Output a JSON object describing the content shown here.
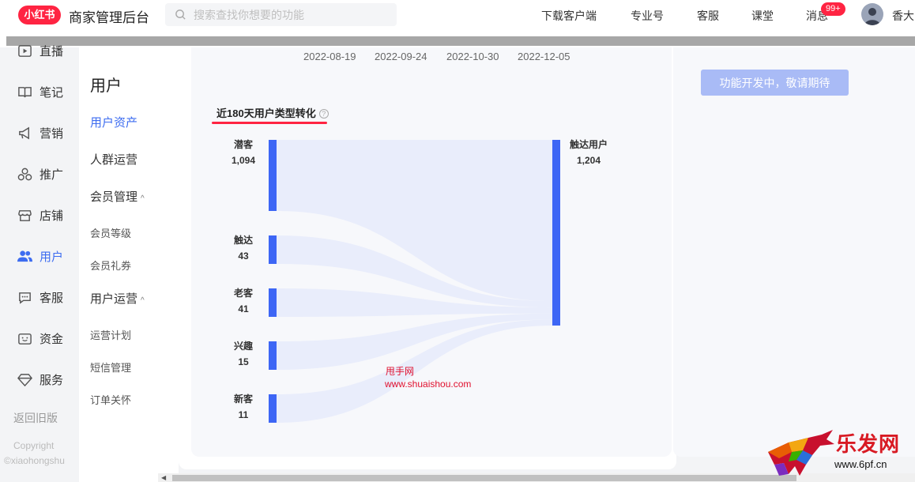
{
  "header": {
    "logo_text": "小红书",
    "app_title": "商家管理后台",
    "search_placeholder": "搜索查找你想要的功能",
    "links": [
      "下载客户端",
      "专业号",
      "客服",
      "课堂",
      "消息"
    ],
    "message_badge": "99+",
    "username": "香大"
  },
  "sidenav": {
    "items": [
      {
        "label": "直播",
        "icon": "play-icon"
      },
      {
        "label": "笔记",
        "icon": "book-icon"
      },
      {
        "label": "营销",
        "icon": "megaphone-icon"
      },
      {
        "label": "推广",
        "icon": "share-nodes-icon"
      },
      {
        "label": "店铺",
        "icon": "store-icon"
      },
      {
        "label": "用户",
        "icon": "users-icon",
        "active": true
      },
      {
        "label": "客服",
        "icon": "chat-icon"
      },
      {
        "label": "资金",
        "icon": "wallet-icon"
      },
      {
        "label": "服务",
        "icon": "diamond-icon"
      }
    ],
    "back_old": "返回旧版",
    "copyright": "Copyright",
    "copyright_sub": "©xiaohongshu"
  },
  "submenu": {
    "title": "用户",
    "items": [
      "用户资产",
      "人群运营",
      "会员管理",
      "会员等级",
      "会员礼券",
      "用户运营",
      "运营计划",
      "短信管理",
      "订单关怀"
    ]
  },
  "main": {
    "dates": [
      "2022-08-19",
      "2022-09-24",
      "2022-10-30",
      "2022-12-05"
    ],
    "chart_title": "近180天用户类型转化",
    "help_glyph": "?"
  },
  "chart_data": {
    "type": "sankey",
    "title": "近180天用户类型转化",
    "sources": [
      {
        "name": "潜客",
        "value": 1094
      },
      {
        "name": "触达",
        "value": 43
      },
      {
        "name": "老客",
        "value": 41
      },
      {
        "name": "兴趣",
        "value": 15
      },
      {
        "name": "新客",
        "value": 11
      }
    ],
    "target": {
      "name": "触达用户",
      "value": 1204
    },
    "value_labels": [
      "1,094",
      "43",
      "41",
      "15",
      "11"
    ],
    "target_label": "1,204",
    "node_color": "#3d66f5",
    "link_color": "#e9edfb"
  },
  "right_panel": {
    "button_label": "功能开发中，敬请期待"
  },
  "watermark": {
    "line1": "甩手网",
    "line2": "www.shuaishou.com"
  },
  "corner_logo": {
    "brand": "乐发网",
    "site": "www.6pf.cn"
  },
  "colors": {
    "brand_red": "#ff2442",
    "accent_blue": "#3d6cf0"
  }
}
